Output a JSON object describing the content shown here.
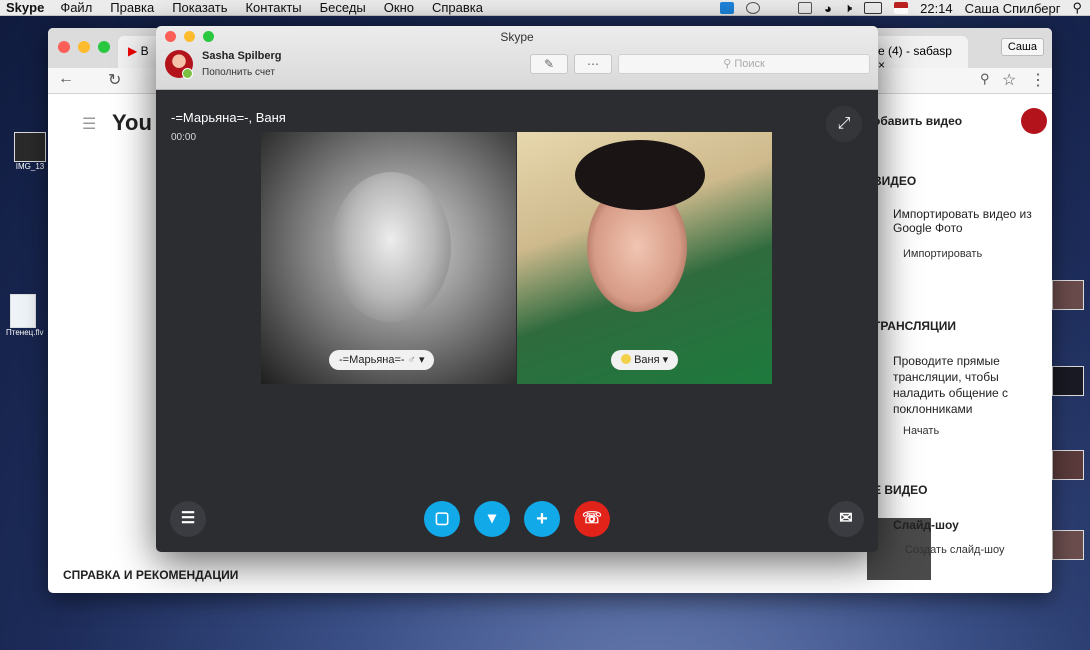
{
  "menubar": {
    "app": "Skype",
    "items": [
      "Файл",
      "Правка",
      "Показать",
      "Контакты",
      "Беседы",
      "Окно",
      "Справка"
    ],
    "time": "22:14",
    "user": "Саша Спилберг"
  },
  "desktop": {
    "icons": [
      {
        "label": "IMG_13"
      },
      {
        "label": "Птенец.flv"
      },
      {
        "label": "FLV"
      }
    ]
  },
  "browser": {
    "tab_left_label": "B",
    "tab_right_label": "e (4) - sабаsp",
    "user_button": "Саша",
    "youtube": {
      "logo": "You",
      "add_video": "обавить видео",
      "section1": "ВИДЕО",
      "import_title": "Импортировать видео из Google Фото",
      "import_btn": "Импортировать",
      "section2": "ТРАНСЛЯЦИИ",
      "stream_text": "Проводите прямые трансляции, чтобы наладить общение с поклонниками",
      "start_btn": "Начать",
      "section3": "Е ВИДЕО",
      "slideshow": "Слайд-шоу",
      "create_slideshow": "Создать слайд-шоу",
      "footer": "СПРАВКА И РЕКОМЕНДАЦИИ"
    }
  },
  "skype": {
    "window_title": "Skype",
    "user_name": "Sasha Spilberg",
    "balance_link": "Пополнить счет",
    "search_placeholder": "Поиск",
    "call": {
      "title": "-=Марьяна=-, Ваня",
      "time": "00:00",
      "participants": [
        {
          "name": "-=Марьяна=-"
        },
        {
          "name": "Ваня"
        }
      ]
    }
  }
}
